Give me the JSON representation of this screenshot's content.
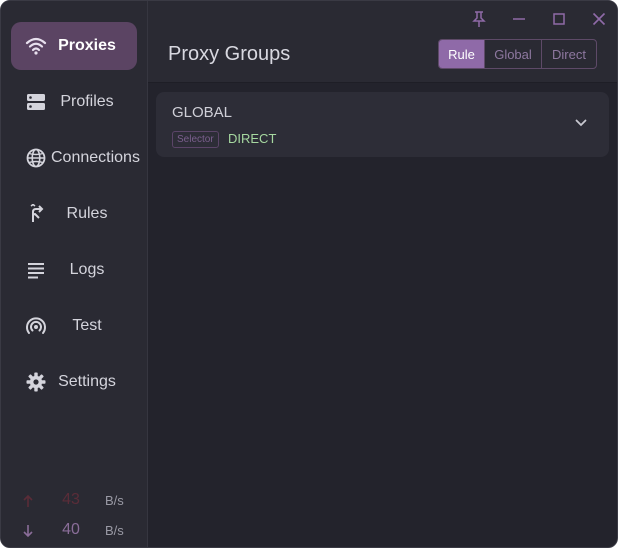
{
  "window_controls": {
    "pin_icon": "pin-icon",
    "minimize_icon": "minimize-icon",
    "maximize_icon": "maximize-icon",
    "close_icon": "close-icon"
  },
  "sidebar": {
    "items": [
      {
        "label": "Proxies",
        "icon": "wifi-icon",
        "active": true
      },
      {
        "label": "Profiles",
        "icon": "server-icon",
        "active": false
      },
      {
        "label": "Connections",
        "icon": "globe-icon",
        "active": false
      },
      {
        "label": "Rules",
        "icon": "fork-icon",
        "active": false
      },
      {
        "label": "Logs",
        "icon": "lines-icon",
        "active": false
      },
      {
        "label": "Test",
        "icon": "radar-icon",
        "active": false
      },
      {
        "label": "Settings",
        "icon": "gear-icon",
        "active": false
      }
    ],
    "traffic": {
      "up": {
        "value": "43",
        "unit": "B/s"
      },
      "down": {
        "value": "40",
        "unit": "B/s"
      }
    }
  },
  "header": {
    "title": "Proxy Groups",
    "modes": [
      {
        "label": "Rule",
        "active": true
      },
      {
        "label": "Global",
        "active": false
      },
      {
        "label": "Direct",
        "active": false
      }
    ]
  },
  "groups": [
    {
      "name": "GLOBAL",
      "type": "Selector",
      "now": "DIRECT"
    }
  ],
  "colors": {
    "accent": "#8f6aa8",
    "active_nav": "#5b4463",
    "selected_proxy": "#a6d8a0"
  }
}
